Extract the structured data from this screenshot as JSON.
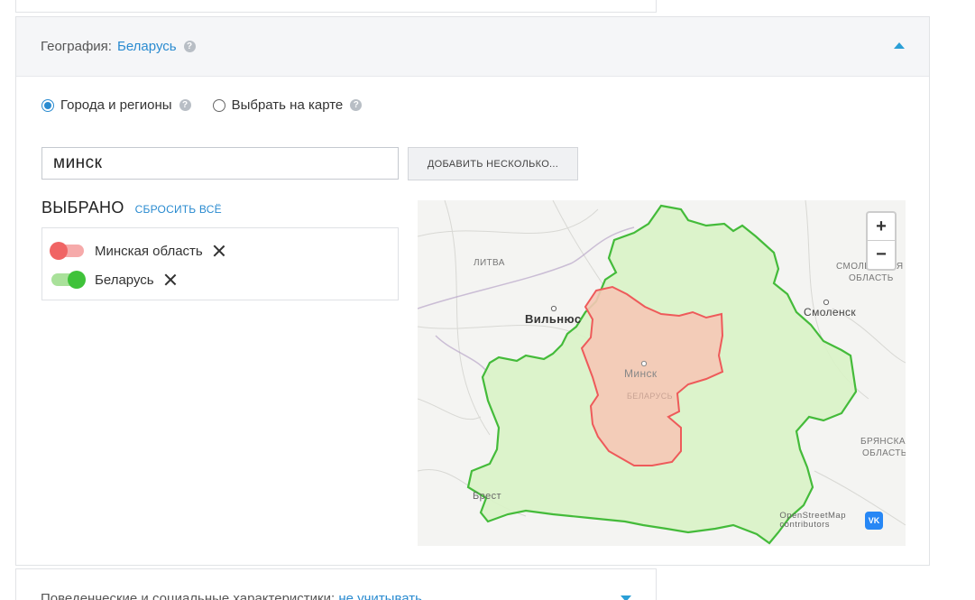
{
  "geography": {
    "label": "География:",
    "value": "Беларусь",
    "help": "?"
  },
  "mode": {
    "options": [
      {
        "label": "Города и регионы",
        "checked": true
      },
      {
        "label": "Выбрать на карте",
        "checked": false
      }
    ]
  },
  "search": {
    "value": "минск"
  },
  "add_multiple_label": "ДОБАВИТЬ НЕСКОЛЬКО...",
  "selected": {
    "title": "ВЫБРАНО",
    "reset_label": "СБРОСИТЬ ВСЁ",
    "items": [
      {
        "label": "Минская область",
        "state": "excluded",
        "color": "#f06464"
      },
      {
        "label": "Беларусь",
        "state": "included",
        "color": "#3fc23a"
      }
    ]
  },
  "map": {
    "labels": {
      "lithuania": "ЛИТВА",
      "vilnius": "Вильнюс",
      "minsk": "Минск",
      "belarus": "БЕЛАРУСЬ",
      "smolensk": "Смоленск",
      "smolensk_region_1": "СМОЛЕНСКАЯ",
      "smolensk_region_2": "ОБЛАСТЬ",
      "bryansk_region_1": "БРЯНСКАЯ",
      "bryansk_region_2": "ОБЛАСТЬ",
      "brest": "Брест"
    },
    "zoom_in": "+",
    "zoom_out": "−",
    "attribution_1": "OpenStreetMap",
    "attribution_2": "contributors",
    "vk_logo": "VK"
  },
  "next_section": {
    "label": "Поведенческие и социальные характеристики:",
    "value": "не учитывать"
  }
}
